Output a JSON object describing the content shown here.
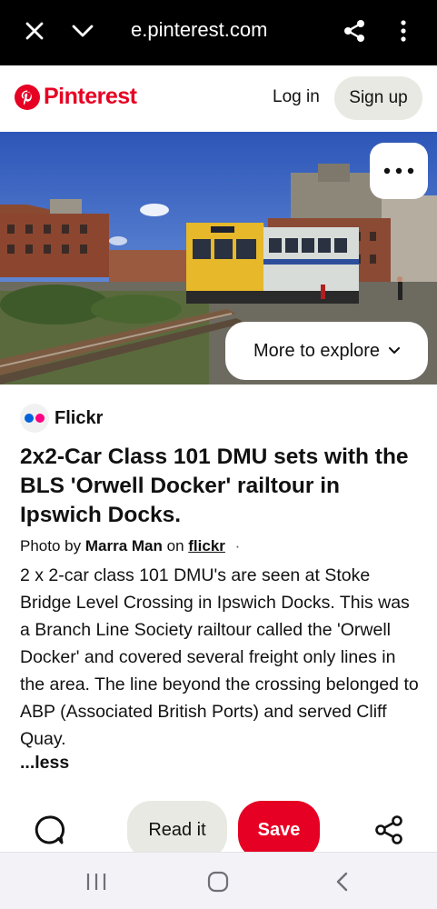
{
  "browser": {
    "url": "e.pinterest.com",
    "icons": [
      "close-icon",
      "chevron-down-icon",
      "share-icon",
      "more-vertical-icon"
    ]
  },
  "header": {
    "logo_text": "Pinterest",
    "login_label": "Log in",
    "signup_label": "Sign up",
    "brand_color": "#e60023"
  },
  "pin": {
    "more_options_icon": "more-horizontal-icon",
    "more_to_explore_label": "More to explore",
    "source": {
      "name": "Flickr",
      "dot_colors": [
        "#0063dc",
        "#ff0084"
      ]
    },
    "title": "2x2-Car Class 101 DMU sets with the BLS 'Orwell Docker' railtour in Ipswich Docks.",
    "credit": {
      "prefix": "Photo by",
      "author": "Marra Man",
      "on": "on",
      "site": "flickr",
      "separator": "·"
    },
    "description": "2 x 2-car class 101 DMU's are seen at Stoke Bridge Level Crossing in Ipswich Docks. This was a Branch Line Society railtour called the 'Orwell Docker' and covered several freight only lines in the area. The line beyond the crossing belonged to ABP (Associated British Ports) and served Cliff Quay.",
    "less_label": "...less"
  },
  "actions": {
    "comment_icon": "comment-icon",
    "read_it_label": "Read it",
    "save_label": "Save",
    "share_icon": "share-icon",
    "save_color": "#e60023"
  },
  "android_nav": {
    "icons": [
      "recent-apps-icon",
      "home-icon",
      "back-icon"
    ]
  }
}
